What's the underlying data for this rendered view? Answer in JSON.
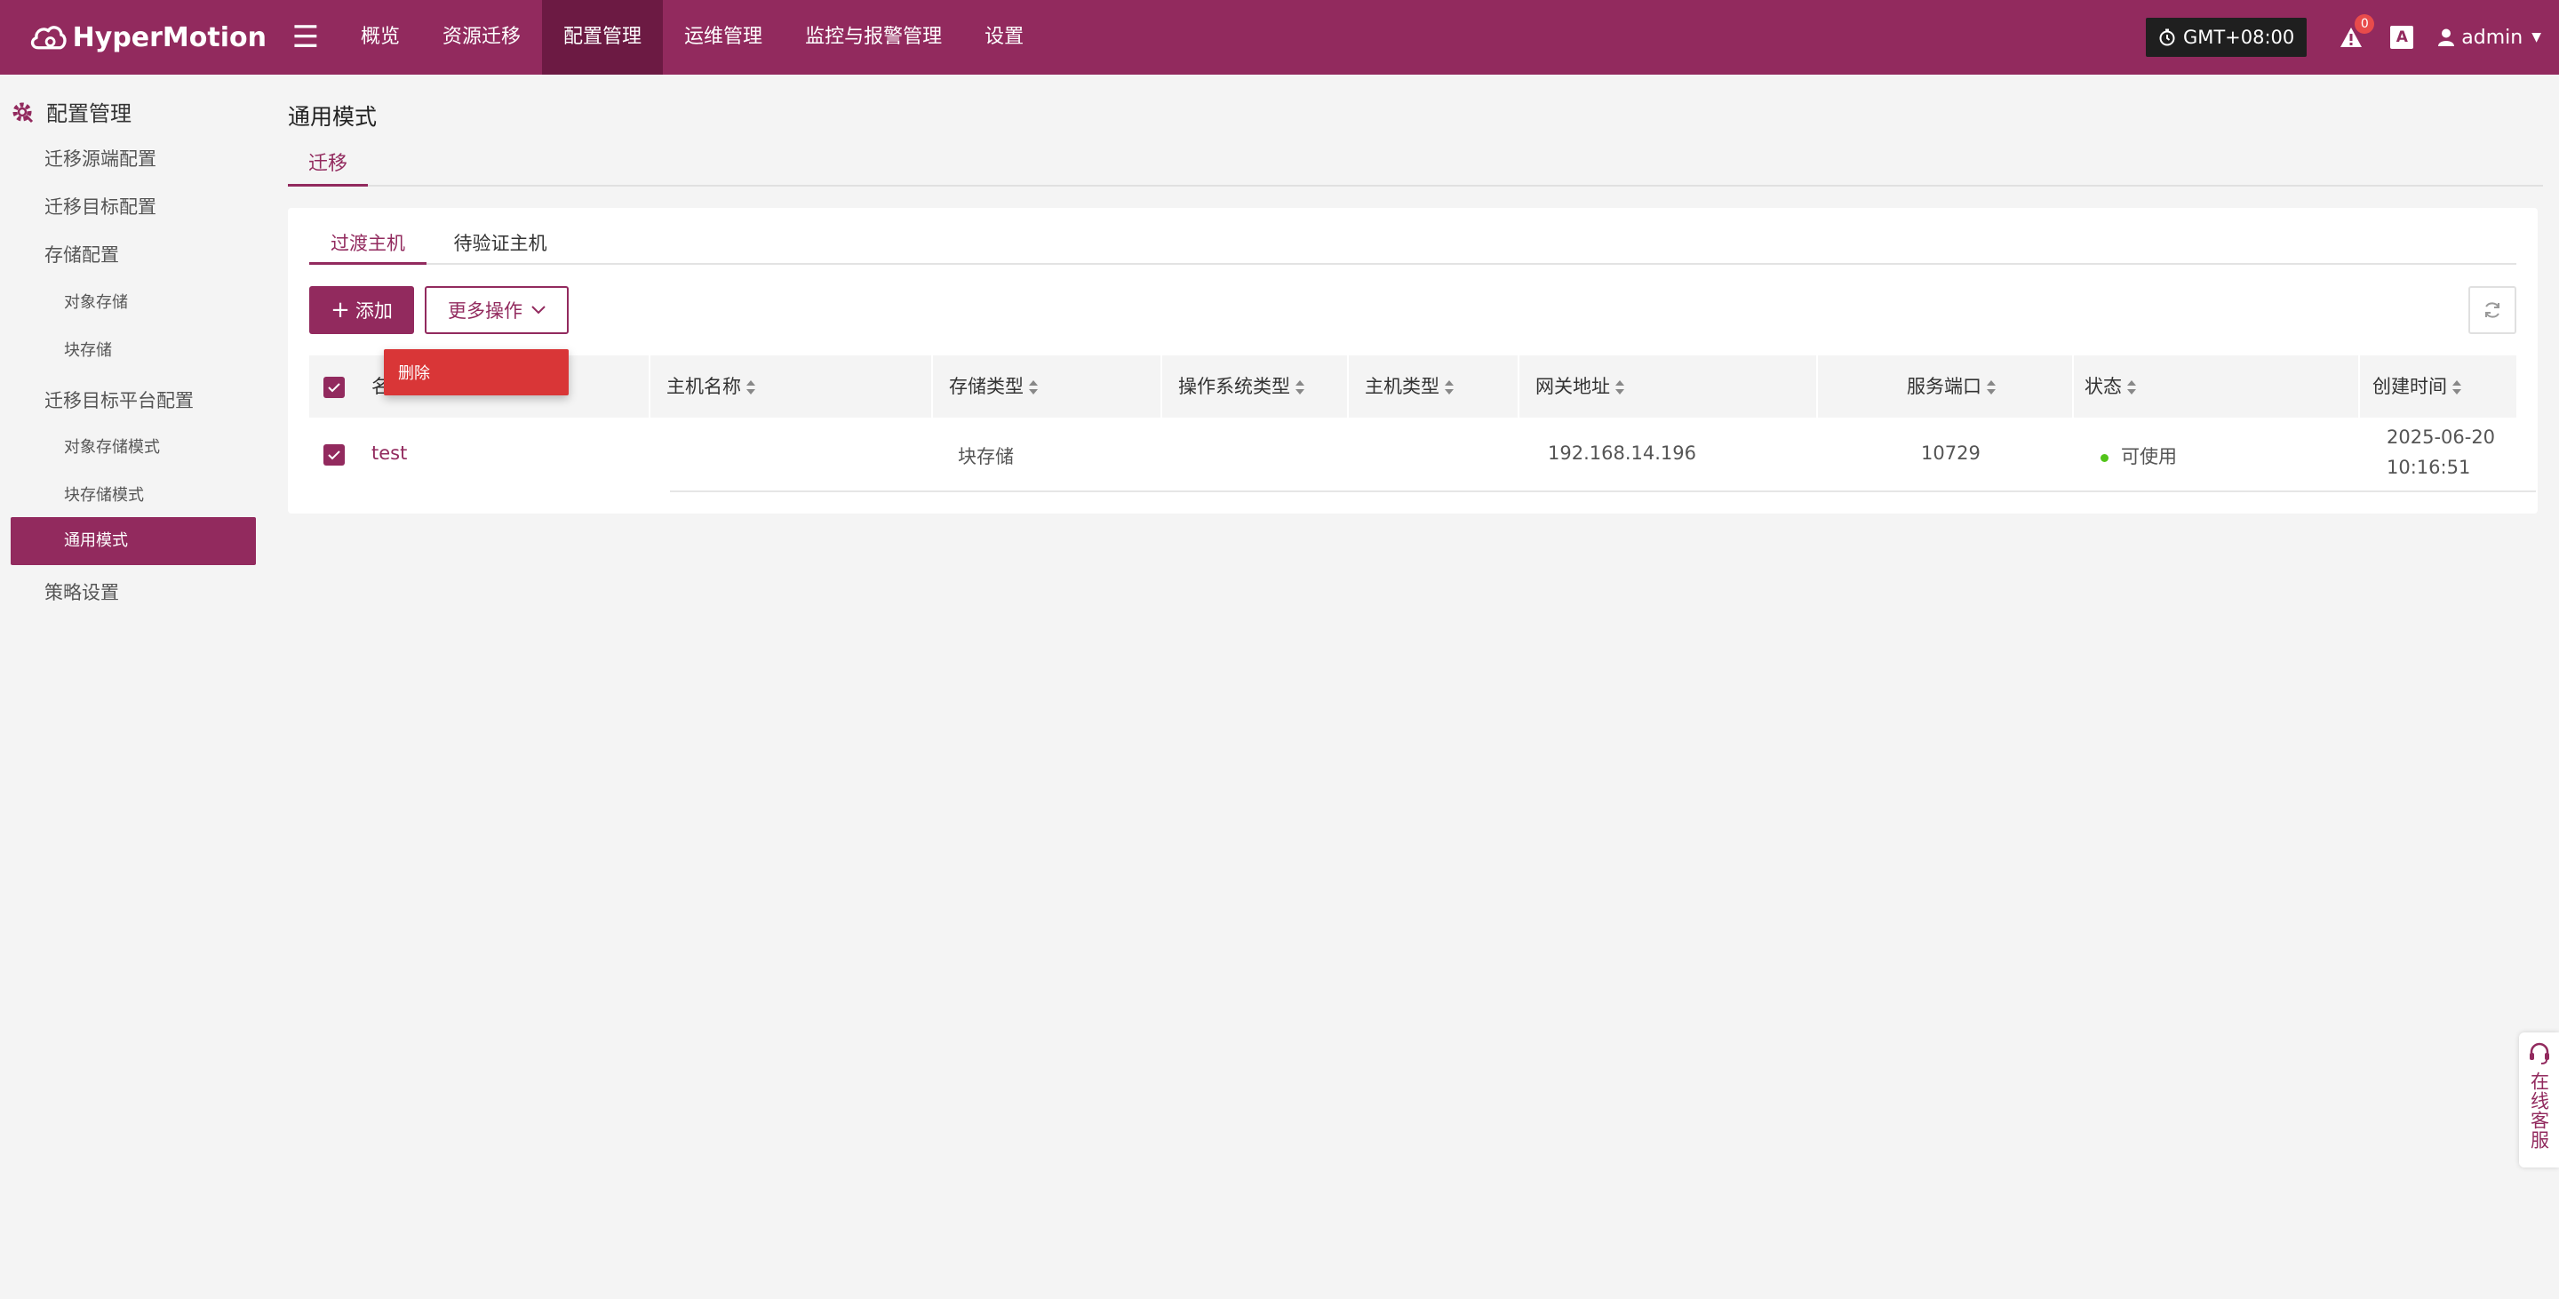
{
  "app": {
    "brand": "HyperMotion"
  },
  "nav": {
    "items": [
      {
        "label": "概览"
      },
      {
        "label": "资源迁移"
      },
      {
        "label": "配置管理",
        "active": true
      },
      {
        "label": "运维管理"
      },
      {
        "label": "监控与报警管理"
      },
      {
        "label": "设置"
      }
    ]
  },
  "header": {
    "timezone": "GMT+08:00",
    "alert_count": "0",
    "lang_icon": "A",
    "user": "admin"
  },
  "sidebar": {
    "title": "配置管理",
    "items": [
      {
        "label": "迁移源端配置",
        "level": 1
      },
      {
        "label": "迁移目标配置",
        "level": 1
      },
      {
        "label": "存储配置",
        "level": 1
      },
      {
        "label": "对象存储",
        "level": 2
      },
      {
        "label": "块存储",
        "level": 2
      },
      {
        "label": "迁移目标平台配置",
        "level": 1
      },
      {
        "label": "对象存储模式",
        "level": 2
      },
      {
        "label": "块存储模式",
        "level": 2
      },
      {
        "label": "通用模式",
        "level": 2,
        "active": true
      },
      {
        "label": "策略设置",
        "level": 1
      }
    ]
  },
  "main": {
    "title": "通用模式",
    "tab": "迁移",
    "sub_tabs": [
      {
        "label": "过渡主机",
        "active": true
      },
      {
        "label": "待验证主机"
      }
    ],
    "toolbar": {
      "add_label": "添加",
      "more_label": "更多操作",
      "dropdown_item": "删除"
    },
    "table": {
      "columns": [
        "名称",
        "主机名称",
        "存储类型",
        "操作系统类型",
        "主机类型",
        "网关地址",
        "服务端口",
        "状态",
        "创建时间"
      ],
      "rows": [
        {
          "name": "test",
          "hostname": "",
          "storage_type": "块存储",
          "os_type": "",
          "host_type": "",
          "gateway": "192.168.14.196",
          "port": "10729",
          "status": "可使用",
          "created_date": "2025-06-20",
          "created_time": "10:16:51"
        }
      ]
    }
  },
  "service": {
    "label": "在线客服"
  },
  "colors": {
    "brand": "#922a5e",
    "nav_active": "#6c1a43",
    "danger": "#d93637",
    "success": "#52c41a"
  }
}
